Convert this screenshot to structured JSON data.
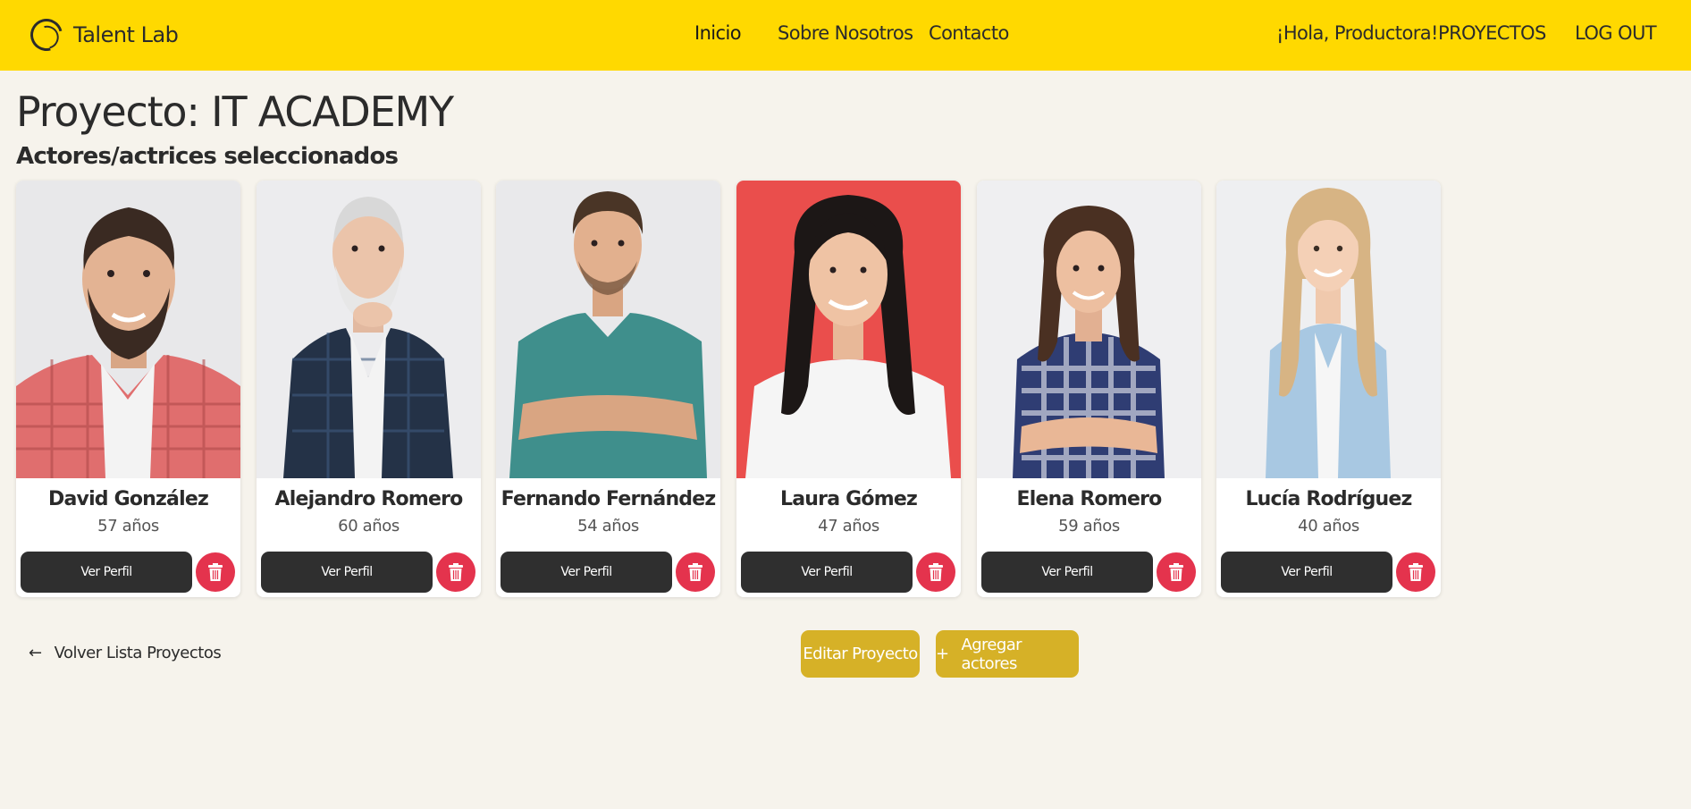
{
  "nav": {
    "brand": "Talent Lab",
    "links": [
      "Inicio",
      "Sobre Nosotros",
      "Contacto"
    ],
    "greeting": "¡Hola, Productora!",
    "projects": "PROYECTOS",
    "logout": "LOG OUT"
  },
  "project": {
    "title": "Proyecto: IT ACADEMY",
    "section_title": "Actores/actrices seleccionados"
  },
  "actors": [
    {
      "name": "David González",
      "age": "57 años",
      "profile_label": "Ver Perfil"
    },
    {
      "name": "Alejandro Romero",
      "age": "60 años",
      "profile_label": "Ver Perfil"
    },
    {
      "name": "Fernando Fernández",
      "age": "54 años",
      "profile_label": "Ver Perfil"
    },
    {
      "name": "Laura Gómez",
      "age": "47 años",
      "profile_label": "Ver Perfil"
    },
    {
      "name": "Elena Romero",
      "age": "59 años",
      "profile_label": "Ver Perfil"
    },
    {
      "name": "Lucía Rodríguez",
      "age": "40 años",
      "profile_label": "Ver Perfil"
    }
  ],
  "actions": {
    "back": "Volver Lista Proyectos",
    "edit": "Editar Proyecto",
    "add": "Agregar actores",
    "add_icon": "+"
  },
  "colors": {
    "navbar": "#ffd900",
    "background": "#f6f3ec",
    "dark_button": "#2f2f2f",
    "delete_button": "#e4334d",
    "gold_button": "#d6b127"
  }
}
